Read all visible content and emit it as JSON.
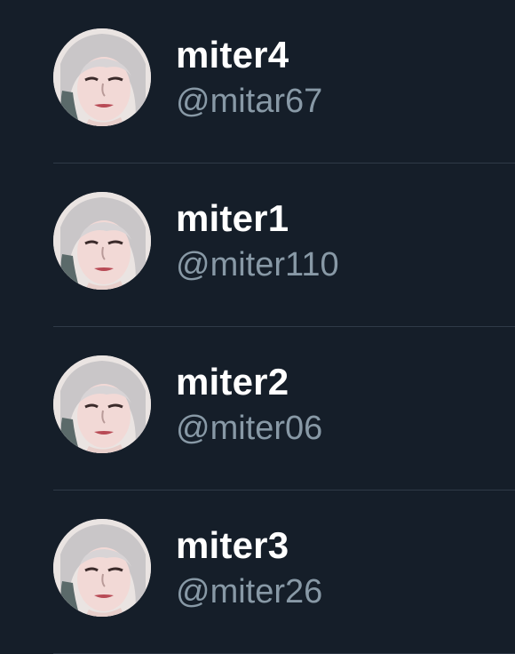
{
  "accounts": [
    {
      "display_name": "miter4",
      "handle": "@mitar67"
    },
    {
      "display_name": "miter1",
      "handle": "@miter110"
    },
    {
      "display_name": "miter2",
      "handle": "@miter06"
    },
    {
      "display_name": "miter3",
      "handle": "@miter26"
    }
  ],
  "colors": {
    "background": "#151e29",
    "name_text": "#ffffff",
    "handle_text": "#8899a6",
    "divider": "#2f3a47"
  }
}
